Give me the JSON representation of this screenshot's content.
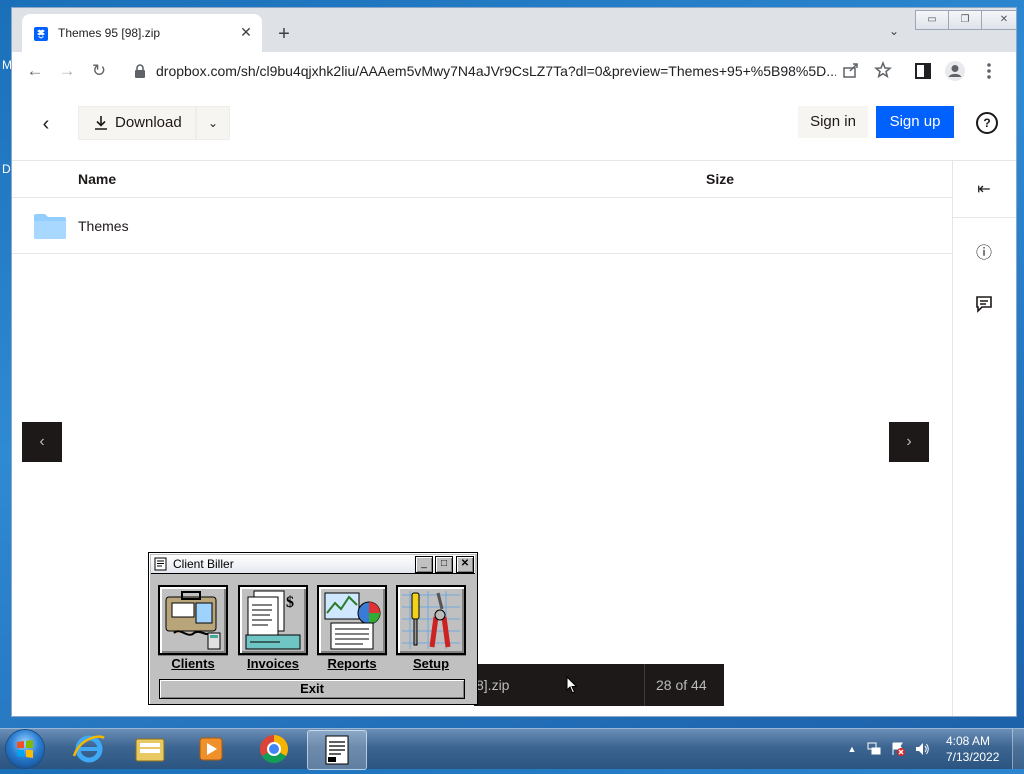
{
  "desktop": {
    "edge_labels": [
      "M",
      "D"
    ]
  },
  "browser": {
    "tab": {
      "title": "Themes 95 [98].zip",
      "favicon": "dropbox-icon",
      "close": "✕"
    },
    "new_tab": "+",
    "tab_list": "⌄",
    "window_controls": {
      "minimize": "▭",
      "restore": "❐",
      "close": "✕"
    },
    "nav": {
      "back": "←",
      "forward": "→",
      "reload": "↻"
    },
    "url": "dropbox.com/sh/cl9bu4qjxhk2liu/AAAem5vMwy7N4aJVr9CsLZ7Ta?dl=0&preview=Themes+95+%5B98%5D...",
    "omnibox_icons": [
      "share-icon",
      "star-icon"
    ],
    "toolbar_icons": [
      "side-panel-icon",
      "profile-icon",
      "menu-icon"
    ]
  },
  "dropbox": {
    "back": "‹",
    "download_label": "Download",
    "download_caret": "⌄",
    "signin_label": "Sign in",
    "signup_label": "Sign up",
    "help": "?",
    "columns": {
      "name": "Name",
      "size": "Size"
    },
    "files": [
      {
        "name": "Themes",
        "type": "folder",
        "size": ""
      }
    ],
    "rail": {
      "collapse": "⇤",
      "info": "ⓘ",
      "comment": "▭"
    },
    "prev": "‹",
    "next": "›",
    "pager": {
      "name_fragment": "8].zip",
      "count": "28 of 44"
    },
    "colors": {
      "signup_bg": "#0061fe",
      "folder": "#92ceff"
    }
  },
  "client_biller": {
    "title": "Client Biller",
    "controls": {
      "minimize": "_",
      "maximize": "□",
      "close": "✕"
    },
    "buttons": [
      {
        "label": "Clients",
        "icon": "clients-icon"
      },
      {
        "label": "Invoices",
        "icon": "invoices-icon"
      },
      {
        "label": "Reports",
        "icon": "reports-icon"
      },
      {
        "label": "Setup",
        "icon": "setup-icon"
      }
    ],
    "exit_label": "Exit"
  },
  "taskbar": {
    "items": [
      "ie-icon",
      "explorer-icon",
      "media-player-icon",
      "chrome-icon",
      "client-biller-icon"
    ],
    "tray": {
      "arrow": "▲",
      "icons": [
        "network-icon",
        "action-center-icon",
        "volume-icon"
      ]
    },
    "time": "4:08 AM",
    "date": "7/13/2022"
  }
}
